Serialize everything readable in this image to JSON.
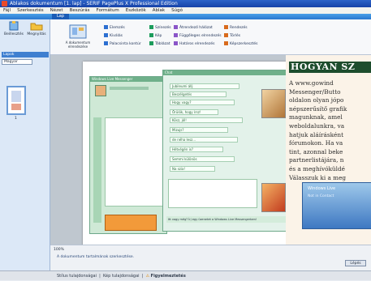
{
  "app": {
    "title": "Ablakos dokumentum [1. lap] - SERIF PagePlus X Professional Edition",
    "menu": [
      "Fájl",
      "Szerkesztés",
      "Nézet",
      "Beszúrás",
      "Formátum",
      "Eszközök",
      "Ablak",
      "Súgó"
    ],
    "main_tab": "Lap"
  },
  "left_panel": {
    "tools": [
      {
        "label": "Beillesztés",
        "icon": "paste-icon"
      },
      {
        "label": "Megnyitás",
        "icon": "open-folder-icon"
      }
    ],
    "panel_title": "Lapok",
    "dropdown_value": "Magyar",
    "page_number": "1"
  },
  "ribbon": {
    "big_button_label": "A dokumentum elrendezése",
    "buttons": [
      {
        "label": "Elemzés",
        "color": "#2c6fd1"
      },
      {
        "label": "Kiválás",
        "color": "#2c6fd1"
      },
      {
        "label": "Palacsinta kontúr",
        "color": "#2c6fd1"
      },
      {
        "label": "Színezés",
        "color": "#1d9c5c"
      },
      {
        "label": "Kép",
        "color": "#1d9c5c"
      },
      {
        "label": "Táblázat",
        "color": "#1d9c5c"
      },
      {
        "label": "Átrendező hálózat",
        "color": "#8a55c8"
      },
      {
        "label": "Függőleges elrendezés",
        "color": "#8a55c8"
      },
      {
        "label": "Határos elrendezés",
        "color": "#8a55c8"
      },
      {
        "label": "Rendezés",
        "color": "#d86b1d"
      },
      {
        "label": "Törlés",
        "color": "#d86b1d"
      },
      {
        "label": "Képszerkesztés",
        "color": "#d86b1d"
      }
    ]
  },
  "canvas": {
    "msn_a_title": "Windows Live Messenger",
    "msn_b_title": "Chat",
    "chat_lines": [
      "Jubileumi állj",
      "Beszélgetés",
      "Hogy vagy?",
      "Örülök, hogy írsz!",
      "Kösz, jól!",
      "Mizujs?",
      "de néha lesz...",
      "Hétvégén is?",
      "Semmi különös",
      "Na szia!"
    ],
    "msn_b_status": "Itt vagy még? Írj egy üzenetet a Windows Live Messengerben!",
    "magazine": {
      "title": "HOGYAN SZ",
      "lines": [
        "A www.gowind",
        "Messenger/Butto",
        "oldalon olyan jópo",
        "népszerűsítő grafik",
        "magunknak, amel",
        "weboldalunkra, va",
        "hatjuk aláírásként",
        "fórumokon. Ha va",
        "tint, azonnal beke",
        "partnerlistájára, n",
        "és a meghívóküldé",
        "Válasszuk ki a meg"
      ],
      "ad_label": "Windows Live",
      "ad_sub": "Not in Contact"
    }
  },
  "zoom": "100%",
  "status": {
    "hint": "A dokumentum tartalmának szerkesztése.",
    "button": "Lépés"
  },
  "bottom_tabs": [
    "Stílus tulajdonságai",
    "Kép tulajdonságai",
    "Figyelmeztetés"
  ]
}
